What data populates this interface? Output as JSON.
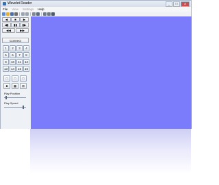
{
  "window": {
    "title": "Wavelet Reader",
    "controls": [
      "_",
      "□",
      "x"
    ]
  },
  "menu": [
    {
      "label": "File",
      "enabled": true
    },
    {
      "label": "View",
      "enabled": false
    },
    {
      "label": "Settings",
      "enabled": false
    },
    {
      "label": "Help",
      "enabled": true
    }
  ],
  "toolbar_icons": [
    {
      "name": "new-file-icon",
      "color": "#5b8bd6"
    },
    {
      "name": "open-folder-icon",
      "color": "#e0b23c"
    },
    {
      "name": "save-icon",
      "color": "#4a6fa8"
    },
    {
      "name": "print-icon",
      "color": "#6d6d6d"
    },
    {
      "name": "cut-icon",
      "color": "#9aa3b0"
    },
    {
      "name": "help-icon",
      "color": "#9aa3b0"
    },
    {
      "name": "pointer-icon",
      "color": "#7d8796"
    },
    {
      "name": "eye-icon",
      "color": "#5a6d86"
    },
    {
      "name": "zoom-icon",
      "color": "#6c7a8c"
    },
    {
      "name": "grid-icon",
      "color": "#6c7a8c"
    },
    {
      "name": "camera-icon",
      "color": "#4f5b6b"
    }
  ],
  "transport": {
    "row1": [
      "◀",
      "■",
      "▶"
    ],
    "row2": [
      "◀▮",
      "▮▮",
      "▮▶"
    ],
    "row3": [
      "◀◀",
      "▶▶"
    ]
  },
  "connect_label": "Connect",
  "channels": [
    "1",
    "2",
    "3",
    "4",
    "5",
    "6",
    "7",
    "8",
    "9",
    "10",
    "11",
    "12",
    "13",
    "14",
    "15",
    "16"
  ],
  "layout_buttons": [
    "□",
    "□",
    "□",
    "■",
    "▦",
    "⊞"
  ],
  "play_position_label": "Play Position",
  "play_speed_label": "Play Speed",
  "play_position_value": 0.05,
  "play_speed_value": 0.9,
  "viewport_color": "#7b7cfb"
}
